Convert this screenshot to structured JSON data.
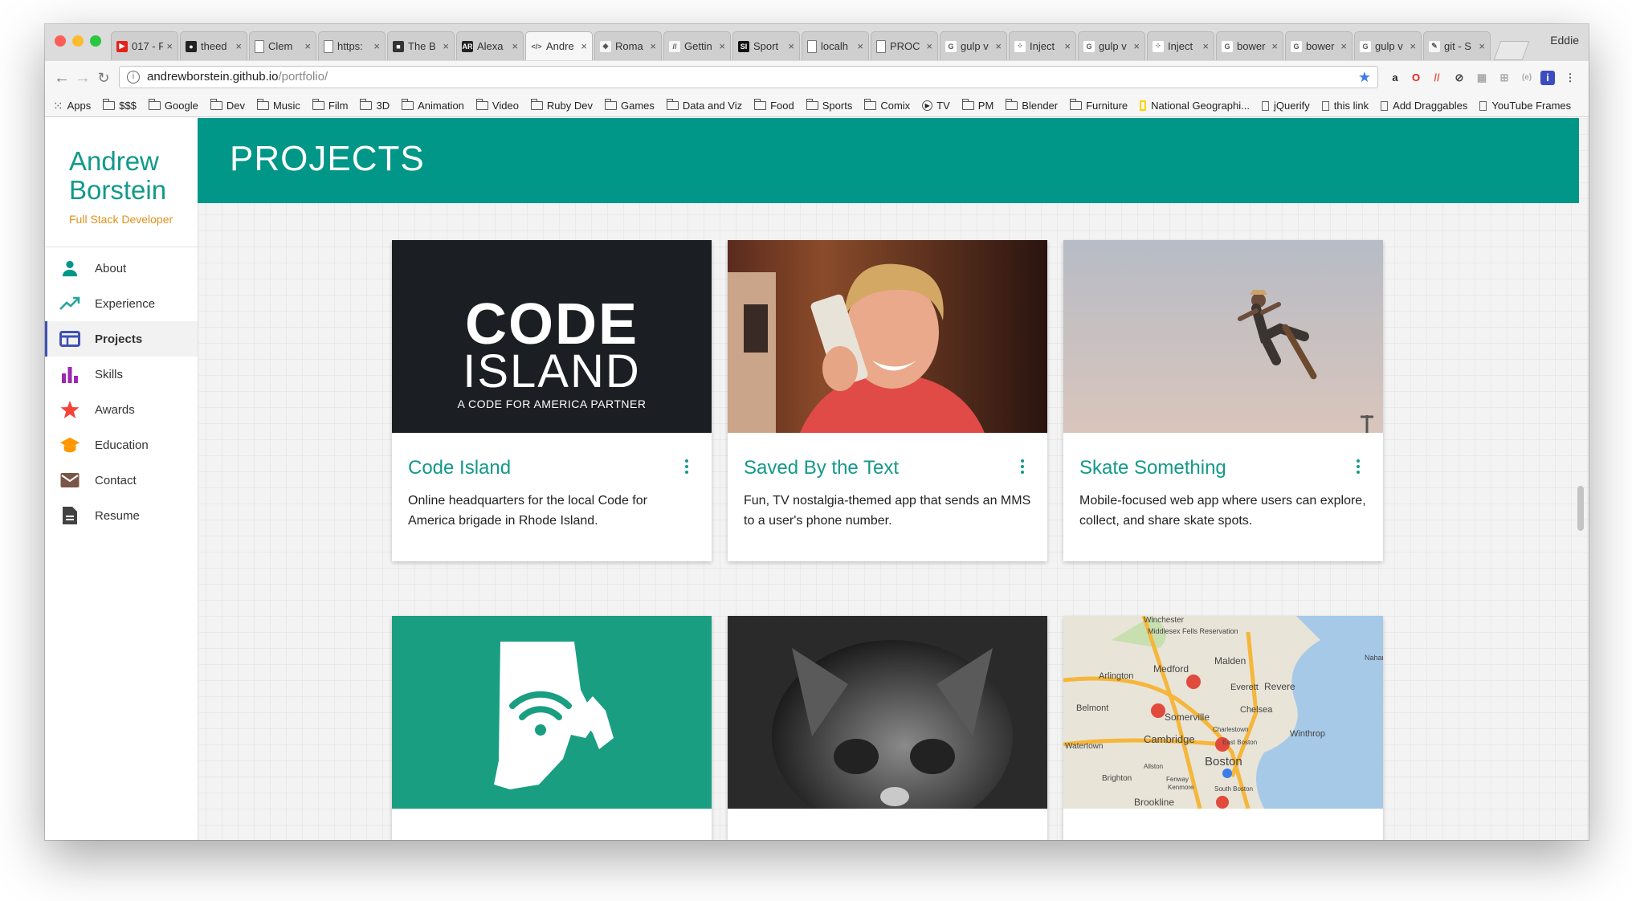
{
  "browser": {
    "profile": "Eddie",
    "tabs": [
      {
        "title": "017 - F",
        "fav_color": "#e62117",
        "fav_glyph": "▶"
      },
      {
        "title": "theed",
        "fav_color": "#222222",
        "fav_glyph": "●"
      },
      {
        "title": "Clem",
        "fav_color": "#ffffff",
        "fav_glyph": ""
      },
      {
        "title": "https:",
        "fav_color": "#ffffff",
        "fav_glyph": ""
      },
      {
        "title": "The B",
        "fav_color": "#333333",
        "fav_glyph": "■"
      },
      {
        "title": "Alexa",
        "fav_color": "#222222",
        "fav_glyph": "AR"
      },
      {
        "title": "Andre",
        "fav_color": "#f6f6f6",
        "fav_glyph": "</>",
        "active": true
      },
      {
        "title": "Roma",
        "fav_color": "#f6f6f6",
        "fav_glyph": "◆"
      },
      {
        "title": "Gettin",
        "fav_color": "#f6f6f6",
        "fav_glyph": "//"
      },
      {
        "title": "Sport",
        "fav_color": "#111111",
        "fav_glyph": "SI"
      },
      {
        "title": "localh",
        "fav_color": "#ffffff",
        "fav_glyph": ""
      },
      {
        "title": "PROC",
        "fav_color": "#ffffff",
        "fav_glyph": ""
      },
      {
        "title": "gulp v",
        "fav_color": "#ffffff",
        "fav_glyph": "G"
      },
      {
        "title": "Inject",
        "fav_color": "#ffffff",
        "fav_glyph": "⁘"
      },
      {
        "title": "gulp v",
        "fav_color": "#ffffff",
        "fav_glyph": "G"
      },
      {
        "title": "Inject",
        "fav_color": "#ffffff",
        "fav_glyph": "⁘"
      },
      {
        "title": "bower",
        "fav_color": "#ffffff",
        "fav_glyph": "G"
      },
      {
        "title": "bower",
        "fav_color": "#ffffff",
        "fav_glyph": "G"
      },
      {
        "title": "gulp v",
        "fav_color": "#ffffff",
        "fav_glyph": "G"
      },
      {
        "title": "git - S",
        "fav_color": "#f6f6f6",
        "fav_glyph": "✎"
      }
    ],
    "url_host": "andrewborstein.github.io",
    "url_path": "/portfolio/",
    "bookmarks": [
      {
        "label": "Apps",
        "kind": "apps"
      },
      {
        "label": "$$$",
        "kind": "folder"
      },
      {
        "label": "Google",
        "kind": "folder"
      },
      {
        "label": "Dev",
        "kind": "folder"
      },
      {
        "label": "Music",
        "kind": "folder"
      },
      {
        "label": "Film",
        "kind": "folder"
      },
      {
        "label": "3D",
        "kind": "folder"
      },
      {
        "label": "Animation",
        "kind": "folder"
      },
      {
        "label": "Video",
        "kind": "folder"
      },
      {
        "label": "Ruby Dev",
        "kind": "folder"
      },
      {
        "label": "Games",
        "kind": "folder"
      },
      {
        "label": "Data and Viz",
        "kind": "folder"
      },
      {
        "label": "Food",
        "kind": "folder"
      },
      {
        "label": "Sports",
        "kind": "folder"
      },
      {
        "label": "Comix",
        "kind": "folder"
      },
      {
        "label": "TV",
        "kind": "play"
      },
      {
        "label": "PM",
        "kind": "folder"
      },
      {
        "label": "Blender",
        "kind": "folder"
      },
      {
        "label": "Furniture",
        "kind": "folder"
      },
      {
        "label": "National Geographi...",
        "kind": "natgeo"
      },
      {
        "label": "jQuerify",
        "kind": "page"
      },
      {
        "label": "this link",
        "kind": "page"
      },
      {
        "label": "Add Draggables",
        "kind": "page"
      },
      {
        "label": "YouTube Frames",
        "kind": "page"
      }
    ]
  },
  "sidebar": {
    "name_first": "Andrew",
    "name_last": "Borstein",
    "tagline": "Full Stack Developer",
    "items": [
      {
        "label": "About",
        "icon": "person-icon",
        "color": "#009688"
      },
      {
        "label": "Experience",
        "icon": "trending-up-icon",
        "color": "#26a69a"
      },
      {
        "label": "Projects",
        "icon": "web-icon",
        "color": "#3f51b5",
        "active": true
      },
      {
        "label": "Skills",
        "icon": "bar-chart-icon",
        "color": "#9c27b0"
      },
      {
        "label": "Awards",
        "icon": "star-icon",
        "color": "#f44336"
      },
      {
        "label": "Education",
        "icon": "school-icon",
        "color": "#ff9800"
      },
      {
        "label": "Contact",
        "icon": "mail-icon",
        "color": "#795548"
      },
      {
        "label": "Resume",
        "icon": "document-icon",
        "color": "#424242"
      }
    ]
  },
  "page": {
    "title": "PROJECTS"
  },
  "projects": [
    {
      "title": "Code Island",
      "description": "Online headquarters for the local Code for America brigade in Rhode Island.",
      "media": "code-island-logo"
    },
    {
      "title": "Saved By the Text",
      "description": "Fun, TV nostalgia-themed app that sends an MMS to a user's phone number.",
      "media": "phone-photo"
    },
    {
      "title": "Skate Something",
      "description": "Mobile-focused web app where users can explore, collect, and share skate spots.",
      "media": "skater-photo"
    },
    {
      "title": "",
      "description": "",
      "media": "rhode-island-wifi"
    },
    {
      "title": "",
      "description": "",
      "media": "kitten-photo"
    },
    {
      "title": "",
      "description": "",
      "media": "boston-map"
    }
  ],
  "code_island_logo": {
    "line1": "CODE",
    "line2": "ISLAND",
    "line3": "A CODE FOR AMERICA PARTNER"
  },
  "map_labels": [
    "Winchester",
    "Middlesex Fells Reservation",
    "Malden",
    "Medford",
    "Everett",
    "Revere",
    "Arlington",
    "Belmont",
    "Somerville",
    "Chelsea",
    "Cambridge",
    "Winthrop",
    "Watertown",
    "Boston",
    "Brighton",
    "Brookline",
    "Charlestown",
    "East Boston",
    "South Boston",
    "Kenmore",
    "Fenway",
    "Allston",
    "Nahant"
  ]
}
